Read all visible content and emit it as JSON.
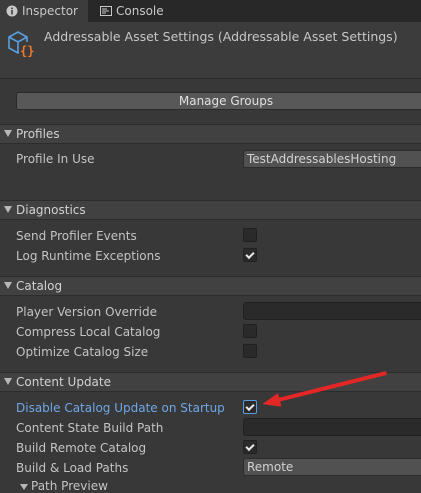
{
  "tabs": [
    {
      "label": "Inspector",
      "icon": "info-icon",
      "active": true
    },
    {
      "label": "Console",
      "icon": "console-icon",
      "active": false
    }
  ],
  "header": {
    "title": "Addressable Asset Settings (Addressable Asset Settings)",
    "icon": "asset-settings-icon"
  },
  "manage_groups_label": "Manage Groups",
  "sections": {
    "profiles": {
      "title": "Profiles",
      "profile_in_use_label": "Profile In Use",
      "profile_in_use_value": "TestAddressablesHosting"
    },
    "diagnostics": {
      "title": "Diagnostics",
      "send_profiler_label": "Send Profiler Events",
      "send_profiler_checked": false,
      "log_runtime_label": "Log Runtime Exceptions",
      "log_runtime_checked": true
    },
    "catalog": {
      "title": "Catalog",
      "player_version_label": "Player Version Override",
      "player_version_value": "",
      "compress_label": "Compress Local Catalog",
      "compress_checked": false,
      "optimize_label": "Optimize Catalog Size",
      "optimize_checked": false
    },
    "content_update": {
      "title": "Content Update",
      "disable_update_label": "Disable Catalog Update on Startup",
      "disable_update_checked": true,
      "state_build_path_label": "Content State Build Path",
      "state_build_path_value": "",
      "build_remote_label": "Build Remote Catalog",
      "build_remote_checked": true,
      "build_load_paths_label": "Build & Load Paths",
      "build_load_paths_value": "Remote",
      "path_preview_label": "Path Preview"
    }
  },
  "colors": {
    "background": "#383838",
    "highlight_label": "#6fa7e6",
    "annotation_arrow": "#e32626"
  }
}
